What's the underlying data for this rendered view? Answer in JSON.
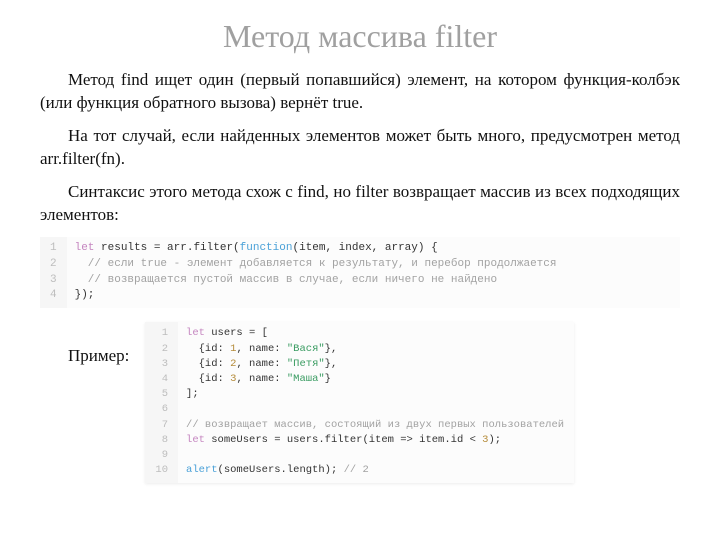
{
  "title": "Метод массива filter",
  "paragraphs": {
    "p1": "Метод find ищет один (первый попавшийся) элемент, на котором функция-колбэк (или функция обратного вызова) вернёт true.",
    "p2": "На тот случай, если найденных элементов может быть много, предусмотрен метод arr.filter(fn).",
    "p3": "Синтаксис этого метода схож с find, но filter возвращает массив из всех подходящих элементов:"
  },
  "example_label": "Пример:",
  "code1": {
    "gutter": [
      "1",
      "2",
      "3",
      "4"
    ],
    "l1_kw": "let",
    "l1_rest1": " results = arr.filter(",
    "l1_fn": "function",
    "l1_rest2": "(item, index, array) {",
    "l2_cmt": "  // если true - элемент добавляется к результату, и перебор продолжается",
    "l3_cmt": "  // возвращается пустой массив в случае, если ничего не найдено",
    "l4": "});"
  },
  "code2": {
    "gutter": [
      "1",
      "2",
      "3",
      "4",
      "5",
      "6",
      "7",
      "8",
      "9",
      "10"
    ],
    "l1_kw": "let",
    "l1_rest": " users = [",
    "l2_a": "  {id: ",
    "l2_n": "1",
    "l2_b": ", name: ",
    "l2_s": "\"Вася\"",
    "l2_c": "},",
    "l3_a": "  {id: ",
    "l3_n": "2",
    "l3_b": ", name: ",
    "l3_s": "\"Петя\"",
    "l3_c": "},",
    "l4_a": "  {id: ",
    "l4_n": "3",
    "l4_b": ", name: ",
    "l4_s": "\"Маша\"",
    "l4_c": "}",
    "l5": "];",
    "l6": "",
    "l7_cmt": "// возвращает массив, состоящий из двух первых пользователей",
    "l8_kw": "let",
    "l8_a": " someUsers = users.filter(item => item.id < ",
    "l8_n": "3",
    "l8_b": ");",
    "l9": "",
    "l10_fn": "alert",
    "l10_a": "(someUsers.length); ",
    "l10_cmt": "// 2"
  }
}
